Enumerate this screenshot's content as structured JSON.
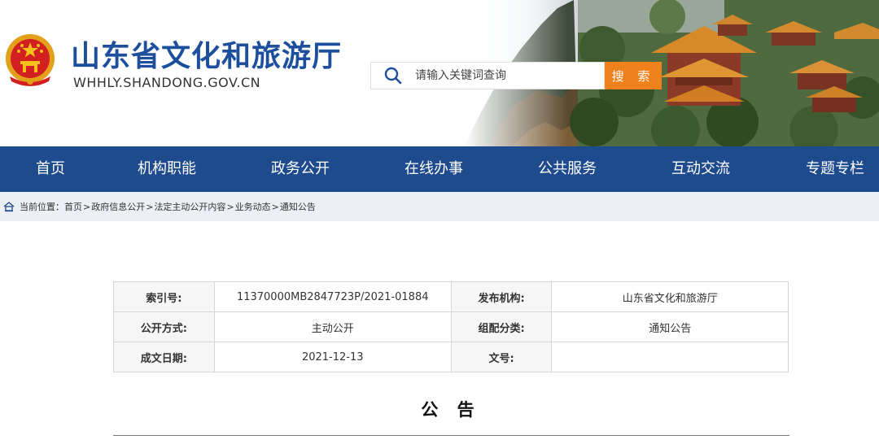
{
  "header": {
    "site_title": "山东省文化和旅游厅",
    "site_domain": "WHHLY.SHANDONG.GOV.CN",
    "search_placeholder": "请输入关键词查询",
    "search_button": "搜 索",
    "brand_color": "#1d4f9c",
    "accent_color": "#f0821e"
  },
  "nav": {
    "bg_color": "#1e4a8e",
    "items": [
      {
        "label": "首页"
      },
      {
        "label": "机构职能"
      },
      {
        "label": "政务公开"
      },
      {
        "label": "在线办事"
      },
      {
        "label": "公共服务"
      },
      {
        "label": "互动交流"
      },
      {
        "label": "专题专栏"
      }
    ]
  },
  "breadcrumb": {
    "prefix": "当前位置：",
    "items": [
      "首页",
      "政府信息公开",
      "法定主动公开内容",
      "业务动态",
      "通知公告"
    ],
    "separator": ">"
  },
  "info_table": {
    "rows": [
      {
        "label1": "索引号:",
        "value1": "11370000MB2847723P/2021-01884",
        "label2": "发布机构:",
        "value2": "山东省文化和旅游厅"
      },
      {
        "label1": "公开方式:",
        "value1": "主动公开",
        "label2": "组配分类:",
        "value2": "通知公告"
      },
      {
        "label1": "成文日期:",
        "value1": "2021-12-13",
        "label2": "文号:",
        "value2": ""
      }
    ]
  },
  "notice_title": "公 告",
  "icons": {
    "emblem": "national-emblem-icon",
    "search": "search-icon",
    "home": "home-icon"
  }
}
